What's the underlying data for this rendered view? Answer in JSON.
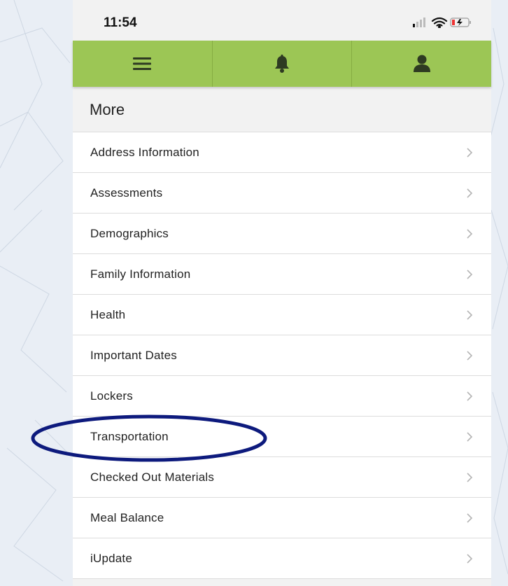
{
  "status": {
    "time": "11:54"
  },
  "nav": {
    "menu_icon": "hamburger-menu-icon",
    "notifications_icon": "bell-icon",
    "profile_icon": "user-icon",
    "color": "#9cc655"
  },
  "page": {
    "title": "More"
  },
  "menu_items": [
    {
      "label": "Address Information"
    },
    {
      "label": "Assessments"
    },
    {
      "label": "Demographics"
    },
    {
      "label": "Family Information"
    },
    {
      "label": "Health"
    },
    {
      "label": "Important Dates"
    },
    {
      "label": "Lockers"
    },
    {
      "label": "Transportation",
      "highlighted": true
    },
    {
      "label": "Checked Out Materials"
    },
    {
      "label": "Meal Balance"
    },
    {
      "label": "iUpdate"
    }
  ],
  "annotation": {
    "type": "ellipse",
    "color": "#0d1a7d",
    "target": "Transportation"
  }
}
